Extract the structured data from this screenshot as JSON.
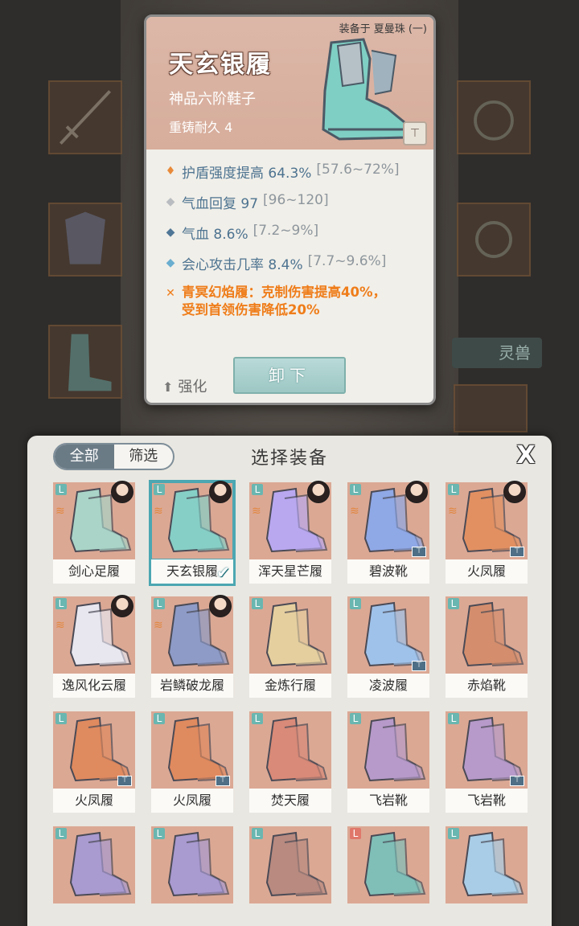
{
  "background": {
    "pet_tab_label": "灵兽"
  },
  "tooltip": {
    "equipped_label": "装备于 夏曼珠 (一)",
    "name": "天玄银履",
    "grade": "神品六阶鞋子",
    "recast": "重铸耐久 4",
    "stats": [
      {
        "icon": "shield-boost-icon",
        "text": "护盾强度提高 64.3%",
        "range": "[57.6~72%]"
      },
      {
        "icon": "diamond-grey-icon",
        "text": "气血回复 97",
        "range": "[96~120]"
      },
      {
        "icon": "diamond-blue-icon",
        "text": "气血 8.6%",
        "range": "[7.2~9%]"
      },
      {
        "icon": "diamond-lightblue-icon",
        "text": "会心攻击几率 8.4%",
        "range": "[7.7~9.6%]"
      }
    ],
    "set_effect": {
      "line1": "青冥幻焰履：克制伤害提高40%，",
      "line2": "受到首领伤害降低20%"
    },
    "upgrade_label": "强化",
    "unload_label": "卸下",
    "lock_glyph": "⊤"
  },
  "panel": {
    "title": "选择装备",
    "filter_all": "全部",
    "filter_screen": "筛选",
    "close_glyph": "X"
  },
  "items": [
    {
      "name": "剑心足履",
      "color": "#dba894",
      "boot": "#a9d4c7",
      "owner": true,
      "set": true,
      "lock": false,
      "selected": false,
      "type_color": "#6ab6b0"
    },
    {
      "name": "天玄银履",
      "color": "#dba894",
      "boot": "#86cfc6",
      "owner": true,
      "set": true,
      "lock": false,
      "selected": true,
      "type_color": "#6ab6b0"
    },
    {
      "name": "浑天星芒履",
      "color": "#dba894",
      "boot": "#b9a8f0",
      "owner": true,
      "set": true,
      "lock": false,
      "selected": false,
      "type_color": "#6ab6b0"
    },
    {
      "name": "碧波靴",
      "color": "#dba894",
      "boot": "#8fa8e6",
      "owner": true,
      "set": true,
      "lock": true,
      "selected": false,
      "type_color": "#6ab6b0"
    },
    {
      "name": "火凤履",
      "color": "#dba894",
      "boot": "#e29062",
      "owner": true,
      "set": true,
      "lock": true,
      "selected": false,
      "type_color": "#6ab6b0"
    },
    {
      "name": "逸风化云履",
      "color": "#dba894",
      "boot": "#e8e6ef",
      "owner": true,
      "set": true,
      "lock": false,
      "selected": false,
      "type_color": "#6ab6b0"
    },
    {
      "name": "岩鳞破龙履",
      "color": "#dba894",
      "boot": "#8e9bc7",
      "owner": true,
      "set": true,
      "lock": false,
      "selected": false,
      "type_color": "#6ab6b0"
    },
    {
      "name": "金炼行履",
      "color": "#dba894",
      "boot": "#e6cf9f",
      "owner": false,
      "set": false,
      "lock": false,
      "selected": false,
      "type_color": "#6ab6b0"
    },
    {
      "name": "凌波履",
      "color": "#dba894",
      "boot": "#9fc2ea",
      "owner": false,
      "set": false,
      "lock": true,
      "selected": false,
      "type_color": "#6ab6b0"
    },
    {
      "name": "赤焰靴",
      "color": "#dba894",
      "boot": "#d48e6d",
      "owner": false,
      "set": false,
      "lock": false,
      "selected": false,
      "type_color": "#6ab6b0"
    },
    {
      "name": "火凤履",
      "color": "#dba894",
      "boot": "#e08a5f",
      "owner": false,
      "set": false,
      "lock": true,
      "selected": false,
      "type_color": "#6ab6b0"
    },
    {
      "name": "火凤履",
      "color": "#dba894",
      "boot": "#e08a5f",
      "owner": false,
      "set": false,
      "lock": true,
      "selected": false,
      "type_color": "#6ab6b0"
    },
    {
      "name": "焚天履",
      "color": "#dba894",
      "boot": "#d98a78",
      "owner": false,
      "set": false,
      "lock": false,
      "selected": false,
      "type_color": "#6ab6b0"
    },
    {
      "name": "飞岩靴",
      "color": "#dba894",
      "boot": "#b79ac9",
      "owner": false,
      "set": false,
      "lock": false,
      "selected": false,
      "type_color": "#6ab6b0"
    },
    {
      "name": "飞岩靴",
      "color": "#dba894",
      "boot": "#b79ac9",
      "owner": false,
      "set": false,
      "lock": true,
      "selected": false,
      "type_color": "#6ab6b0"
    },
    {
      "name": "",
      "color": "#dba894",
      "boot": "#a99ad0",
      "owner": false,
      "set": false,
      "lock": false,
      "selected": false,
      "type_color": "#6ab6b0"
    },
    {
      "name": "",
      "color": "#dba894",
      "boot": "#a99ad0",
      "owner": false,
      "set": false,
      "lock": false,
      "selected": false,
      "type_color": "#6ab6b0"
    },
    {
      "name": "",
      "color": "#dba894",
      "boot": "#b88a80",
      "owner": false,
      "set": false,
      "lock": false,
      "selected": false,
      "type_color": "#6ab6b0"
    },
    {
      "name": "",
      "color": "#dba894",
      "boot": "#7fbfb8",
      "owner": false,
      "set": false,
      "lock": false,
      "selected": false,
      "type_color": "#e0776b"
    },
    {
      "name": "",
      "color": "#dba894",
      "boot": "#a9cde6",
      "owner": false,
      "set": false,
      "lock": false,
      "selected": false,
      "type_color": "#6ab6b0"
    }
  ],
  "type_glyph": "L",
  "set_glyph": "≋",
  "lock_glyph": "⊤",
  "check_glyph": "✔"
}
